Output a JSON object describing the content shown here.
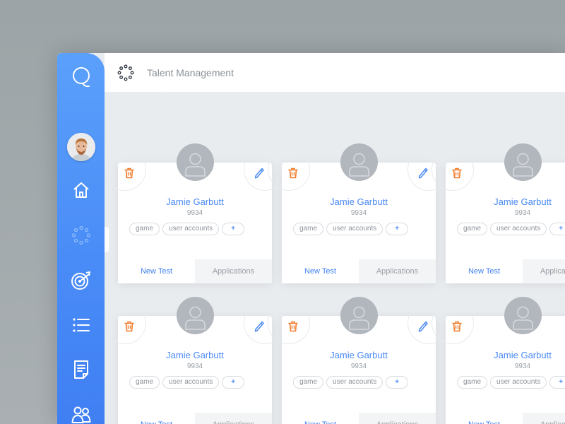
{
  "app": {
    "title": "Talent Management",
    "accent": "#4a8af4",
    "sidebar_gradient": [
      "#5aa0fb",
      "#3f7ff3"
    ]
  },
  "sidebar": {
    "items": [
      {
        "name": "search",
        "icon": "search-icon"
      },
      {
        "name": "profile",
        "icon": "avatar"
      },
      {
        "name": "home",
        "icon": "home-icon"
      },
      {
        "name": "talent",
        "icon": "dots-circle-icon",
        "active": true
      },
      {
        "name": "targets",
        "icon": "target-icon"
      },
      {
        "name": "list",
        "icon": "list-icon"
      },
      {
        "name": "documents",
        "icon": "document-icon"
      },
      {
        "name": "team",
        "icon": "users-icon"
      }
    ]
  },
  "cards": [
    {
      "name": "Jamie Garbutt",
      "id": "9934",
      "tags": [
        "game",
        "user accounts"
      ],
      "add_label": "+",
      "tab_primary": "New Test",
      "tab_secondary": "Applications"
    },
    {
      "name": "Jamie Garbutt",
      "id": "9934",
      "tags": [
        "game",
        "user accounts"
      ],
      "add_label": "+",
      "tab_primary": "New Test",
      "tab_secondary": "Applications"
    },
    {
      "name": "Jamie Garbutt",
      "id": "9934",
      "tags": [
        "game",
        "user accounts"
      ],
      "add_label": "+",
      "tab_primary": "New Test",
      "tab_secondary": "Applications"
    },
    {
      "name": "Jamie Garbutt",
      "id": "9934",
      "tags": [
        "game",
        "user accounts"
      ],
      "add_label": "+",
      "tab_primary": "New Test",
      "tab_secondary": "Applications"
    },
    {
      "name": "Jamie Garbutt",
      "id": "9934",
      "tags": [
        "game",
        "user accounts"
      ],
      "add_label": "+",
      "tab_primary": "New Test",
      "tab_secondary": "Applications"
    },
    {
      "name": "Jamie Garbutt",
      "id": "9934",
      "tags": [
        "game",
        "user accounts"
      ],
      "add_label": "+",
      "tab_primary": "New Test",
      "tab_secondary": "Applications"
    }
  ],
  "icons": {
    "delete": "trash-icon",
    "edit": "pencil-icon"
  },
  "colors": {
    "delete": "#f07b2a",
    "edit": "#4a8af4",
    "card_avatar": "#b2b7bd"
  }
}
